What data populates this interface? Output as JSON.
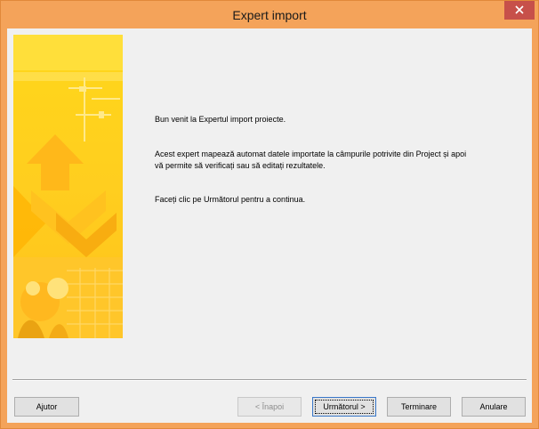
{
  "window": {
    "title": "Expert import"
  },
  "content": {
    "welcome": "Bun venit la Expertul import proiecte.",
    "description_line1": "Acest expert mapează automat datele importate la câmpurile potrivite din Project și apoi",
    "description_line2": "vă permite să verificați sau să editați rezultatele.",
    "instruction": "Faceți clic pe Următorul pentru a continua."
  },
  "buttons": {
    "help": "Ajutor",
    "back": "< Înapoi",
    "next": "Următorul >",
    "finish": "Terminare",
    "cancel": "Anulare"
  },
  "colors": {
    "title_bar": "#f4a35a",
    "close_button": "#c7504a",
    "banner_yellow": "#ffd21f"
  }
}
